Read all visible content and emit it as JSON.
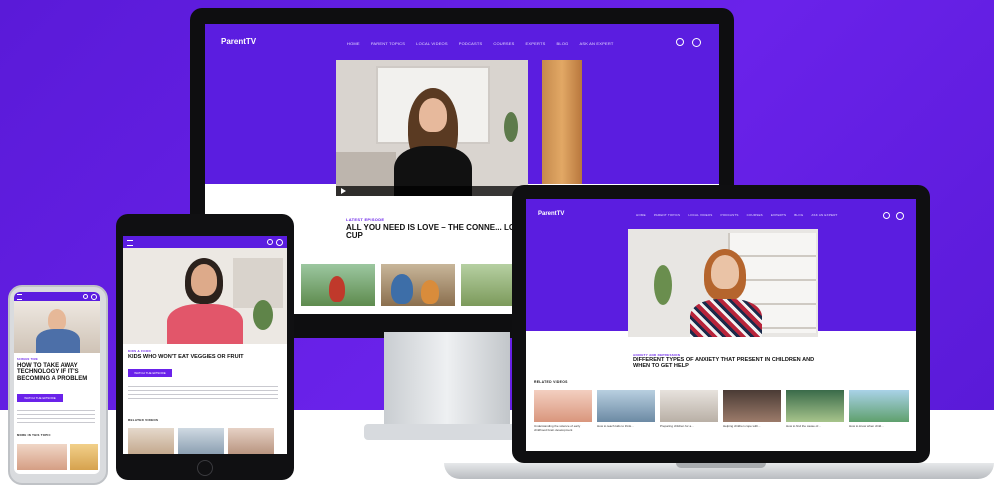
{
  "brand": {
    "part1": "Parent",
    "part2": "TV"
  },
  "desktop": {
    "nav": [
      "HOME",
      "PARENT TOPICS",
      "LOCAL VIDEOS",
      "PODCASTS",
      "COURSES",
      "EXPERTS",
      "BLOG",
      "ASK AN EXPERT"
    ],
    "kicker": "LATEST EPISODE",
    "title": "ALL YOU NEED IS LOVE – THE CONNE... LOVE CUP"
  },
  "laptop": {
    "nav": [
      "HOME",
      "PARENT TOPICS",
      "LOCAL VIDEOS",
      "PODCASTS",
      "COURSES",
      "EXPERTS",
      "BLOG",
      "ASK AN EXPERT"
    ],
    "kicker": "ANXIETY AND DEPRESSION",
    "title": "DIFFERENT TYPES OF ANXIETY THAT PRESENT IN CHILDREN AND WHEN TO GET HELP",
    "related_heading": "RELATED VIDEOS",
    "related": [
      {
        "caption": "Understanding the science of early childhood brain development"
      },
      {
        "caption": "How to teach kids to think..."
      },
      {
        "caption": "Preparing children for a..."
      },
      {
        "caption": "Helping children cope with..."
      },
      {
        "caption": "How to find the cause of..."
      },
      {
        "caption": "How to know when child..."
      }
    ]
  },
  "tablet": {
    "kicker": "KIDS & FOOD",
    "title": "KIDS WHO WON'T EAT VEGGIES OR FRUIT",
    "button": "WATCH THE EPISODE",
    "related_heading": "RELATED VIDEOS"
  },
  "phone": {
    "kicker": "SCREEN TIME",
    "title": "HOW TO TAKE AWAY TECHNOLOGY IF IT'S BECOMING A PROBLEM",
    "button": "WATCH THE EPISODE",
    "more_heading": "MORE IN THIS TOPIC"
  },
  "colors": {
    "accent": "#6a22ea",
    "nav": "#5b1de0"
  }
}
